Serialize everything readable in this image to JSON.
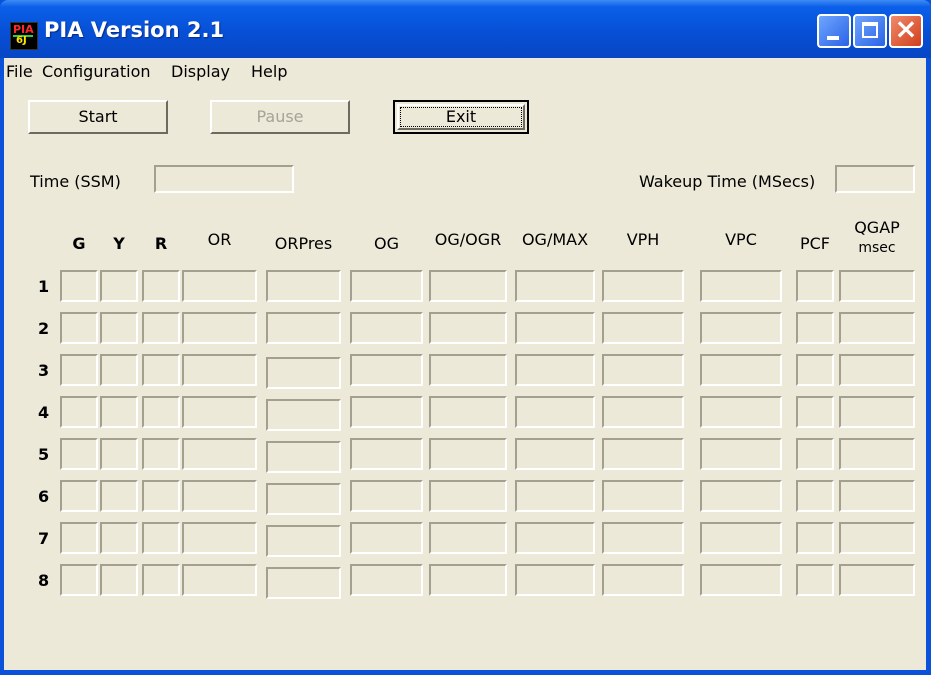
{
  "window": {
    "title": "PIA Version 2.1",
    "icon_text_top": "PIA",
    "icon_text_bottom": "6J"
  },
  "menu": [
    "File",
    "Configuration",
    "Display",
    "Help"
  ],
  "buttons": {
    "start": "Start",
    "pause": "Pause",
    "exit": "Exit"
  },
  "time_label": "Time (SSM)",
  "wakeup_label": "Wakeup Time (MSecs)",
  "columns": [
    "G",
    "Y",
    "R",
    "OR",
    "ORPres",
    "OG",
    "OG/OGR",
    "OG/MAX",
    "VPH",
    "VPC",
    "PCF",
    "QGAP",
    "msec"
  ],
  "rows": [
    "1",
    "2",
    "3",
    "4",
    "5",
    "6",
    "7",
    "8"
  ]
}
